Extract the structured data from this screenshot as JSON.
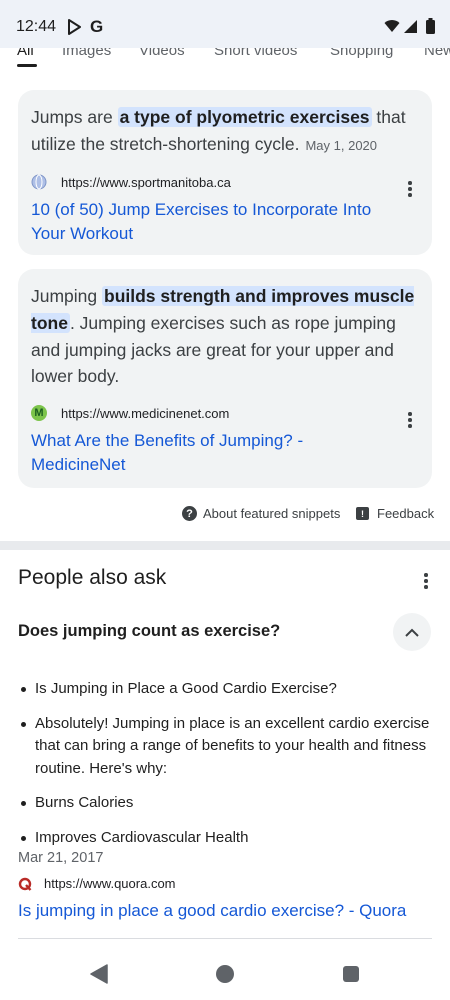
{
  "status_bar": {
    "time": "12:44",
    "g_label": "G"
  },
  "tabs": [
    {
      "label": "All",
      "active": true
    },
    {
      "label": "Images"
    },
    {
      "label": "Videos"
    },
    {
      "label": "Short videos"
    },
    {
      "label": "Shopping"
    },
    {
      "label": "New"
    }
  ],
  "snippets": [
    {
      "text_before": "Jumps are ",
      "highlight": "a type of plyometric exercises",
      "text_after": " that utilize the stretch-shortening cycle.",
      "date": "May 1, 2020",
      "source_url": "https://www.sportmanitoba.ca",
      "link_title": "10 (of 50) Jump Exercises to Incorporate Into Your Workout"
    },
    {
      "text_before": "Jumping ",
      "highlight": "builds strength and improves muscle tone",
      "text_after": ". Jumping exercises such as rope jumping and jumping jacks are great for your upper and lower body.",
      "favicon_letter": "M",
      "source_url": "https://www.medicinenet.com",
      "link_title": "What Are the Benefits of Jumping? - MedicineNet"
    }
  ],
  "about_snippets": "About featured snippets",
  "feedback": "Feedback",
  "people_also_ask": {
    "title": "People also ask",
    "question": "Does jumping count as exercise?",
    "answer_bullets": [
      "Is Jumping in Place a Good Cardio Exercise?",
      "Absolutely! Jumping in place is an excellent cardio exercise that can bring a range of benefits to your health and fitness routine. Here's why:",
      "Burns Calories",
      "Improves Cardiovascular Health"
    ],
    "answer_date": "Mar 21, 2017",
    "source_url": "https://www.quora.com",
    "link_title": "Is jumping in place a good cardio exercise? - Quora"
  },
  "colors": {
    "link": "#1558d6",
    "highlight_bg": "#d3e3fd",
    "card_bg": "#f1f3f4",
    "status_bg": "#eef2f8"
  }
}
